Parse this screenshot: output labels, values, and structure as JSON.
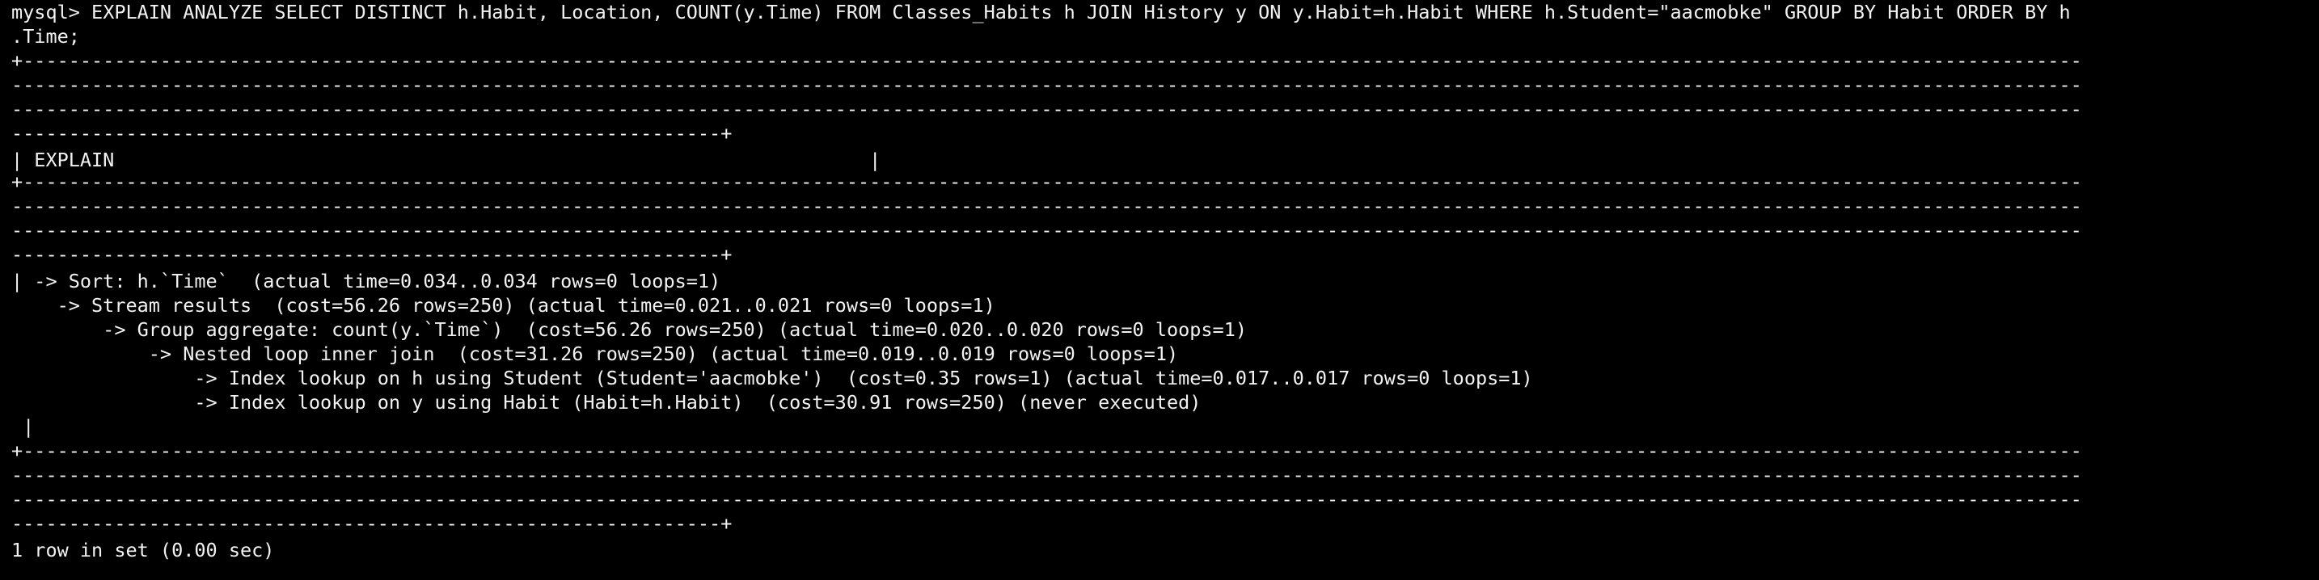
{
  "terminal": {
    "background": "#000000",
    "foreground": "#f2f2f2",
    "prompt": "mysql> ",
    "command_line_1": "EXPLAIN ANALYZE SELECT DISTINCT h.Habit, Location, COUNT(y.Time) FROM Classes_Habits h JOIN History y ON y.Habit=h.Habit WHERE h.Student=\"aacmobke\" GROUP BY Habit ORDER BY h",
    "command_line_2": ".Time;",
    "border_top_1": "+------------------------------------------------------------------------------------------------------------------------------------------------------------------------------------",
    "border_top_2": "-------------------------------------------------------------------------------------------------------------------------------------------------------------------------------------",
    "border_top_3": "-------------------------------------------------------------------------------------------------------------------------------------------------------------------------------------",
    "border_top_4": "--------------------------------------------------------------+",
    "header_row": "| EXPLAIN                                                                  |",
    "border_mid_1": "+------------------------------------------------------------------------------------------------------------------------------------------------------------------------------------",
    "border_mid_2": "-------------------------------------------------------------------------------------------------------------------------------------------------------------------------------------",
    "border_mid_3": "-------------------------------------------------------------------------------------------------------------------------------------------------------------------------------------",
    "border_mid_4": "--------------------------------------------------------------+",
    "plan_lines": [
      "| -> Sort: h.`Time`  (actual time=0.034..0.034 rows=0 loops=1)",
      "    -> Stream results  (cost=56.26 rows=250) (actual time=0.021..0.021 rows=0 loops=1)",
      "        -> Group aggregate: count(y.`Time`)  (cost=56.26 rows=250) (actual time=0.020..0.020 rows=0 loops=1)",
      "            -> Nested loop inner join  (cost=31.26 rows=250) (actual time=0.019..0.019 rows=0 loops=1)",
      "                -> Index lookup on h using Student (Student='aacmobke')  (cost=0.35 rows=1) (actual time=0.017..0.017 rows=0 loops=1)",
      "                -> Index lookup on y using Habit (Habit=h.Habit)  (cost=30.91 rows=250) (never executed)",
      " |"
    ],
    "border_bottom_1": "+------------------------------------------------------------------------------------------------------------------------------------------------------------------------------------",
    "border_bottom_2": "-------------------------------------------------------------------------------------------------------------------------------------------------------------------------------------",
    "border_bottom_3": "-------------------------------------------------------------------------------------------------------------------------------------------------------------------------------------",
    "border_bottom_4": "--------------------------------------------------------------+",
    "result_summary": "1 row in set (0.00 sec)"
  }
}
